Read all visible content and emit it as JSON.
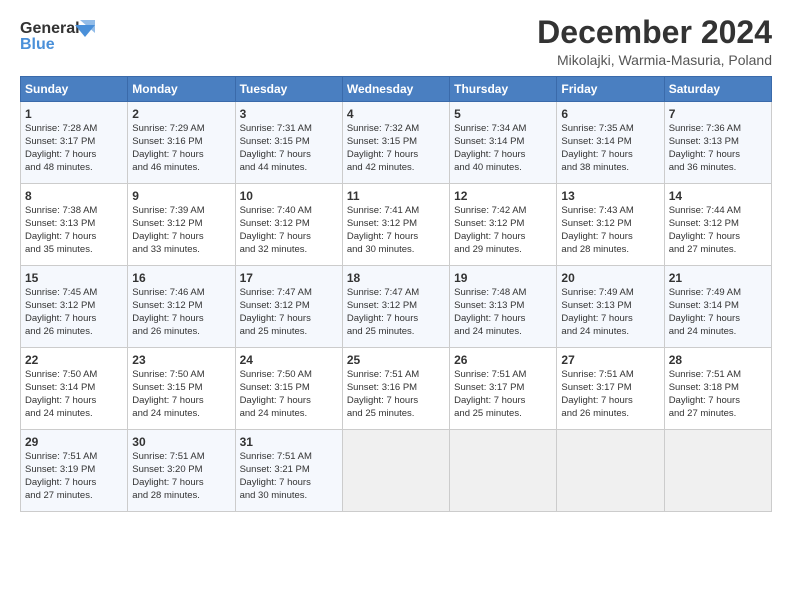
{
  "header": {
    "logo_line1": "General",
    "logo_line2": "Blue",
    "title": "December 2024",
    "subtitle": "Mikolajki, Warmia-Masuria, Poland"
  },
  "days_of_week": [
    "Sunday",
    "Monday",
    "Tuesday",
    "Wednesday",
    "Thursday",
    "Friday",
    "Saturday"
  ],
  "weeks": [
    [
      {
        "day": "1",
        "lines": [
          "Sunrise: 7:28 AM",
          "Sunset: 3:17 PM",
          "Daylight: 7 hours",
          "and 48 minutes."
        ]
      },
      {
        "day": "2",
        "lines": [
          "Sunrise: 7:29 AM",
          "Sunset: 3:16 PM",
          "Daylight: 7 hours",
          "and 46 minutes."
        ]
      },
      {
        "day": "3",
        "lines": [
          "Sunrise: 7:31 AM",
          "Sunset: 3:15 PM",
          "Daylight: 7 hours",
          "and 44 minutes."
        ]
      },
      {
        "day": "4",
        "lines": [
          "Sunrise: 7:32 AM",
          "Sunset: 3:15 PM",
          "Daylight: 7 hours",
          "and 42 minutes."
        ]
      },
      {
        "day": "5",
        "lines": [
          "Sunrise: 7:34 AM",
          "Sunset: 3:14 PM",
          "Daylight: 7 hours",
          "and 40 minutes."
        ]
      },
      {
        "day": "6",
        "lines": [
          "Sunrise: 7:35 AM",
          "Sunset: 3:14 PM",
          "Daylight: 7 hours",
          "and 38 minutes."
        ]
      },
      {
        "day": "7",
        "lines": [
          "Sunrise: 7:36 AM",
          "Sunset: 3:13 PM",
          "Daylight: 7 hours",
          "and 36 minutes."
        ]
      }
    ],
    [
      {
        "day": "8",
        "lines": [
          "Sunrise: 7:38 AM",
          "Sunset: 3:13 PM",
          "Daylight: 7 hours",
          "and 35 minutes."
        ]
      },
      {
        "day": "9",
        "lines": [
          "Sunrise: 7:39 AM",
          "Sunset: 3:12 PM",
          "Daylight: 7 hours",
          "and 33 minutes."
        ]
      },
      {
        "day": "10",
        "lines": [
          "Sunrise: 7:40 AM",
          "Sunset: 3:12 PM",
          "Daylight: 7 hours",
          "and 32 minutes."
        ]
      },
      {
        "day": "11",
        "lines": [
          "Sunrise: 7:41 AM",
          "Sunset: 3:12 PM",
          "Daylight: 7 hours",
          "and 30 minutes."
        ]
      },
      {
        "day": "12",
        "lines": [
          "Sunrise: 7:42 AM",
          "Sunset: 3:12 PM",
          "Daylight: 7 hours",
          "and 29 minutes."
        ]
      },
      {
        "day": "13",
        "lines": [
          "Sunrise: 7:43 AM",
          "Sunset: 3:12 PM",
          "Daylight: 7 hours",
          "and 28 minutes."
        ]
      },
      {
        "day": "14",
        "lines": [
          "Sunrise: 7:44 AM",
          "Sunset: 3:12 PM",
          "Daylight: 7 hours",
          "and 27 minutes."
        ]
      }
    ],
    [
      {
        "day": "15",
        "lines": [
          "Sunrise: 7:45 AM",
          "Sunset: 3:12 PM",
          "Daylight: 7 hours",
          "and 26 minutes."
        ]
      },
      {
        "day": "16",
        "lines": [
          "Sunrise: 7:46 AM",
          "Sunset: 3:12 PM",
          "Daylight: 7 hours",
          "and 26 minutes."
        ]
      },
      {
        "day": "17",
        "lines": [
          "Sunrise: 7:47 AM",
          "Sunset: 3:12 PM",
          "Daylight: 7 hours",
          "and 25 minutes."
        ]
      },
      {
        "day": "18",
        "lines": [
          "Sunrise: 7:47 AM",
          "Sunset: 3:12 PM",
          "Daylight: 7 hours",
          "and 25 minutes."
        ]
      },
      {
        "day": "19",
        "lines": [
          "Sunrise: 7:48 AM",
          "Sunset: 3:13 PM",
          "Daylight: 7 hours",
          "and 24 minutes."
        ]
      },
      {
        "day": "20",
        "lines": [
          "Sunrise: 7:49 AM",
          "Sunset: 3:13 PM",
          "Daylight: 7 hours",
          "and 24 minutes."
        ]
      },
      {
        "day": "21",
        "lines": [
          "Sunrise: 7:49 AM",
          "Sunset: 3:14 PM",
          "Daylight: 7 hours",
          "and 24 minutes."
        ]
      }
    ],
    [
      {
        "day": "22",
        "lines": [
          "Sunrise: 7:50 AM",
          "Sunset: 3:14 PM",
          "Daylight: 7 hours",
          "and 24 minutes."
        ]
      },
      {
        "day": "23",
        "lines": [
          "Sunrise: 7:50 AM",
          "Sunset: 3:15 PM",
          "Daylight: 7 hours",
          "and 24 minutes."
        ]
      },
      {
        "day": "24",
        "lines": [
          "Sunrise: 7:50 AM",
          "Sunset: 3:15 PM",
          "Daylight: 7 hours",
          "and 24 minutes."
        ]
      },
      {
        "day": "25",
        "lines": [
          "Sunrise: 7:51 AM",
          "Sunset: 3:16 PM",
          "Daylight: 7 hours",
          "and 25 minutes."
        ]
      },
      {
        "day": "26",
        "lines": [
          "Sunrise: 7:51 AM",
          "Sunset: 3:17 PM",
          "Daylight: 7 hours",
          "and 25 minutes."
        ]
      },
      {
        "day": "27",
        "lines": [
          "Sunrise: 7:51 AM",
          "Sunset: 3:17 PM",
          "Daylight: 7 hours",
          "and 26 minutes."
        ]
      },
      {
        "day": "28",
        "lines": [
          "Sunrise: 7:51 AM",
          "Sunset: 3:18 PM",
          "Daylight: 7 hours",
          "and 27 minutes."
        ]
      }
    ],
    [
      {
        "day": "29",
        "lines": [
          "Sunrise: 7:51 AM",
          "Sunset: 3:19 PM",
          "Daylight: 7 hours",
          "and 27 minutes."
        ]
      },
      {
        "day": "30",
        "lines": [
          "Sunrise: 7:51 AM",
          "Sunset: 3:20 PM",
          "Daylight: 7 hours",
          "and 28 minutes."
        ]
      },
      {
        "day": "31",
        "lines": [
          "Sunrise: 7:51 AM",
          "Sunset: 3:21 PM",
          "Daylight: 7 hours",
          "and 30 minutes."
        ]
      },
      {
        "day": "",
        "lines": []
      },
      {
        "day": "",
        "lines": []
      },
      {
        "day": "",
        "lines": []
      },
      {
        "day": "",
        "lines": []
      }
    ]
  ]
}
